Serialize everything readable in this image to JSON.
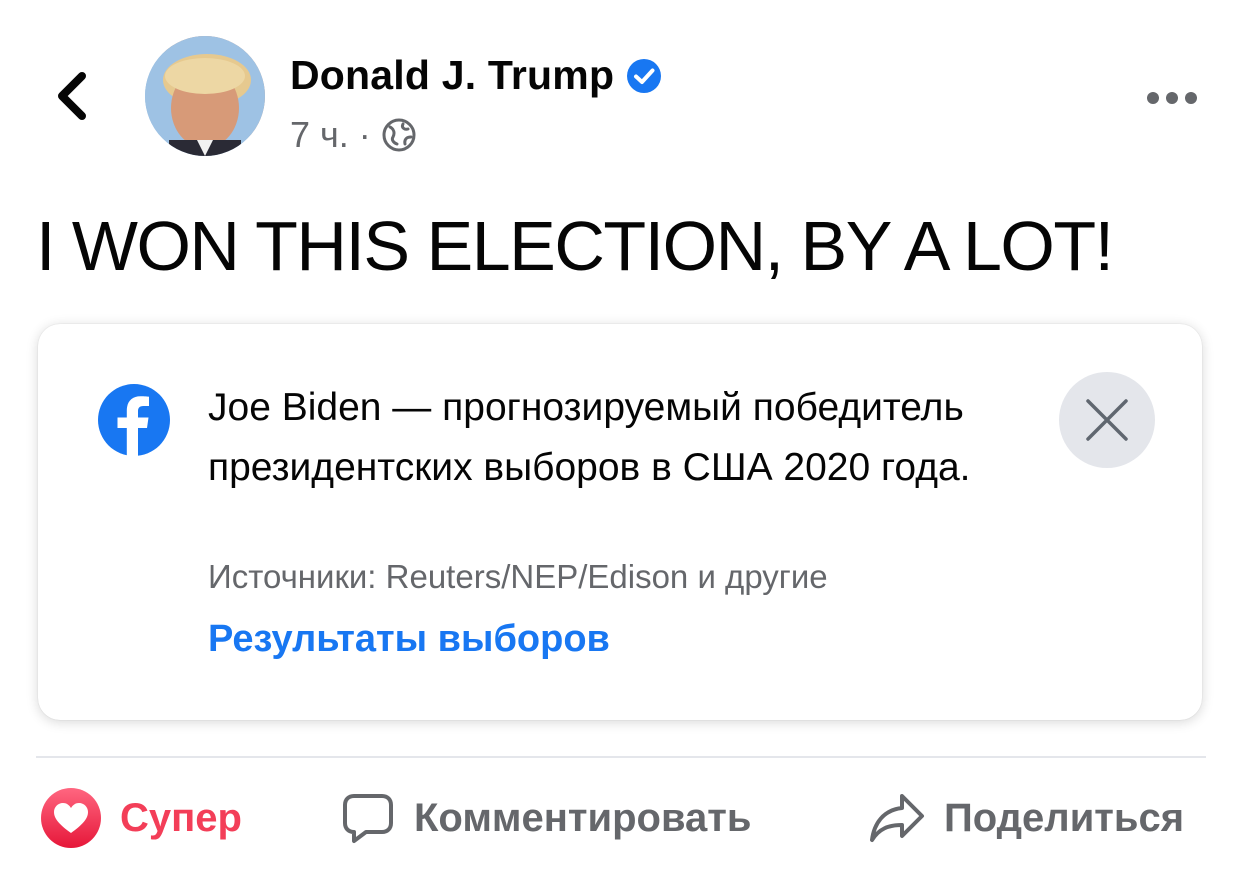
{
  "header": {
    "author_name": "Donald J. Trump",
    "time": "7 ч.",
    "separator": "·"
  },
  "post": {
    "text": "I WON THIS ELECTION, BY A LOT!"
  },
  "info_card": {
    "message": "Joe Biden  — прогнозируемый победитель президентских выборов в США 2020 года.",
    "source": "Источники: Reuters/NEP/Edison и другие",
    "link_label": "Результаты выборов"
  },
  "actions": {
    "react_label": "Супер",
    "comment_label": "Комментировать",
    "share_label": "Поделиться"
  },
  "colors": {
    "brand_blue": "#1877f2",
    "love_red": "#f33e58",
    "secondary_text": "#65676b"
  },
  "icons": {
    "back": "chevron-left-icon",
    "verified": "verified-badge-icon",
    "audience": "globe-icon",
    "more": "more-dots-icon",
    "card_logo": "facebook-logo-icon",
    "close": "close-icon",
    "react": "love-reaction-icon",
    "comment": "comment-icon",
    "share": "share-icon"
  }
}
